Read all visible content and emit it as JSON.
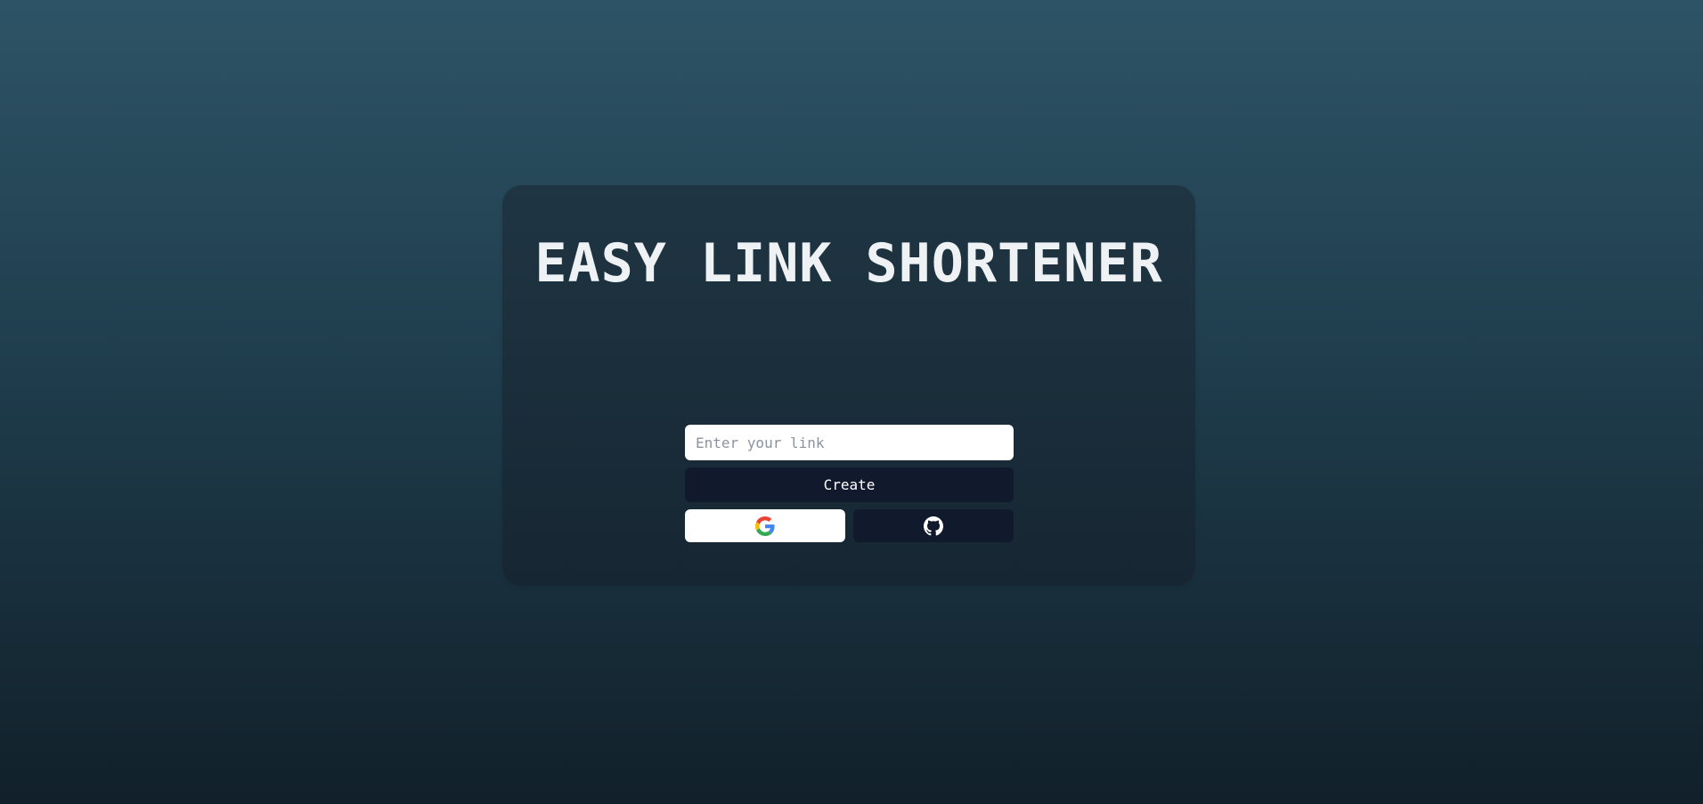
{
  "title": "EASY LINK SHORTENER",
  "form": {
    "input_value": "",
    "input_placeholder": "Enter your link",
    "create_label": "Create"
  },
  "oauth": {
    "google_icon": "google-icon",
    "github_icon": "github-icon"
  },
  "colors": {
    "background_top": "#2d5466",
    "background_bottom": "#11202a",
    "card": "#1f3442",
    "button_dark": "#111a2c",
    "title_text": "#eef2f4"
  }
}
